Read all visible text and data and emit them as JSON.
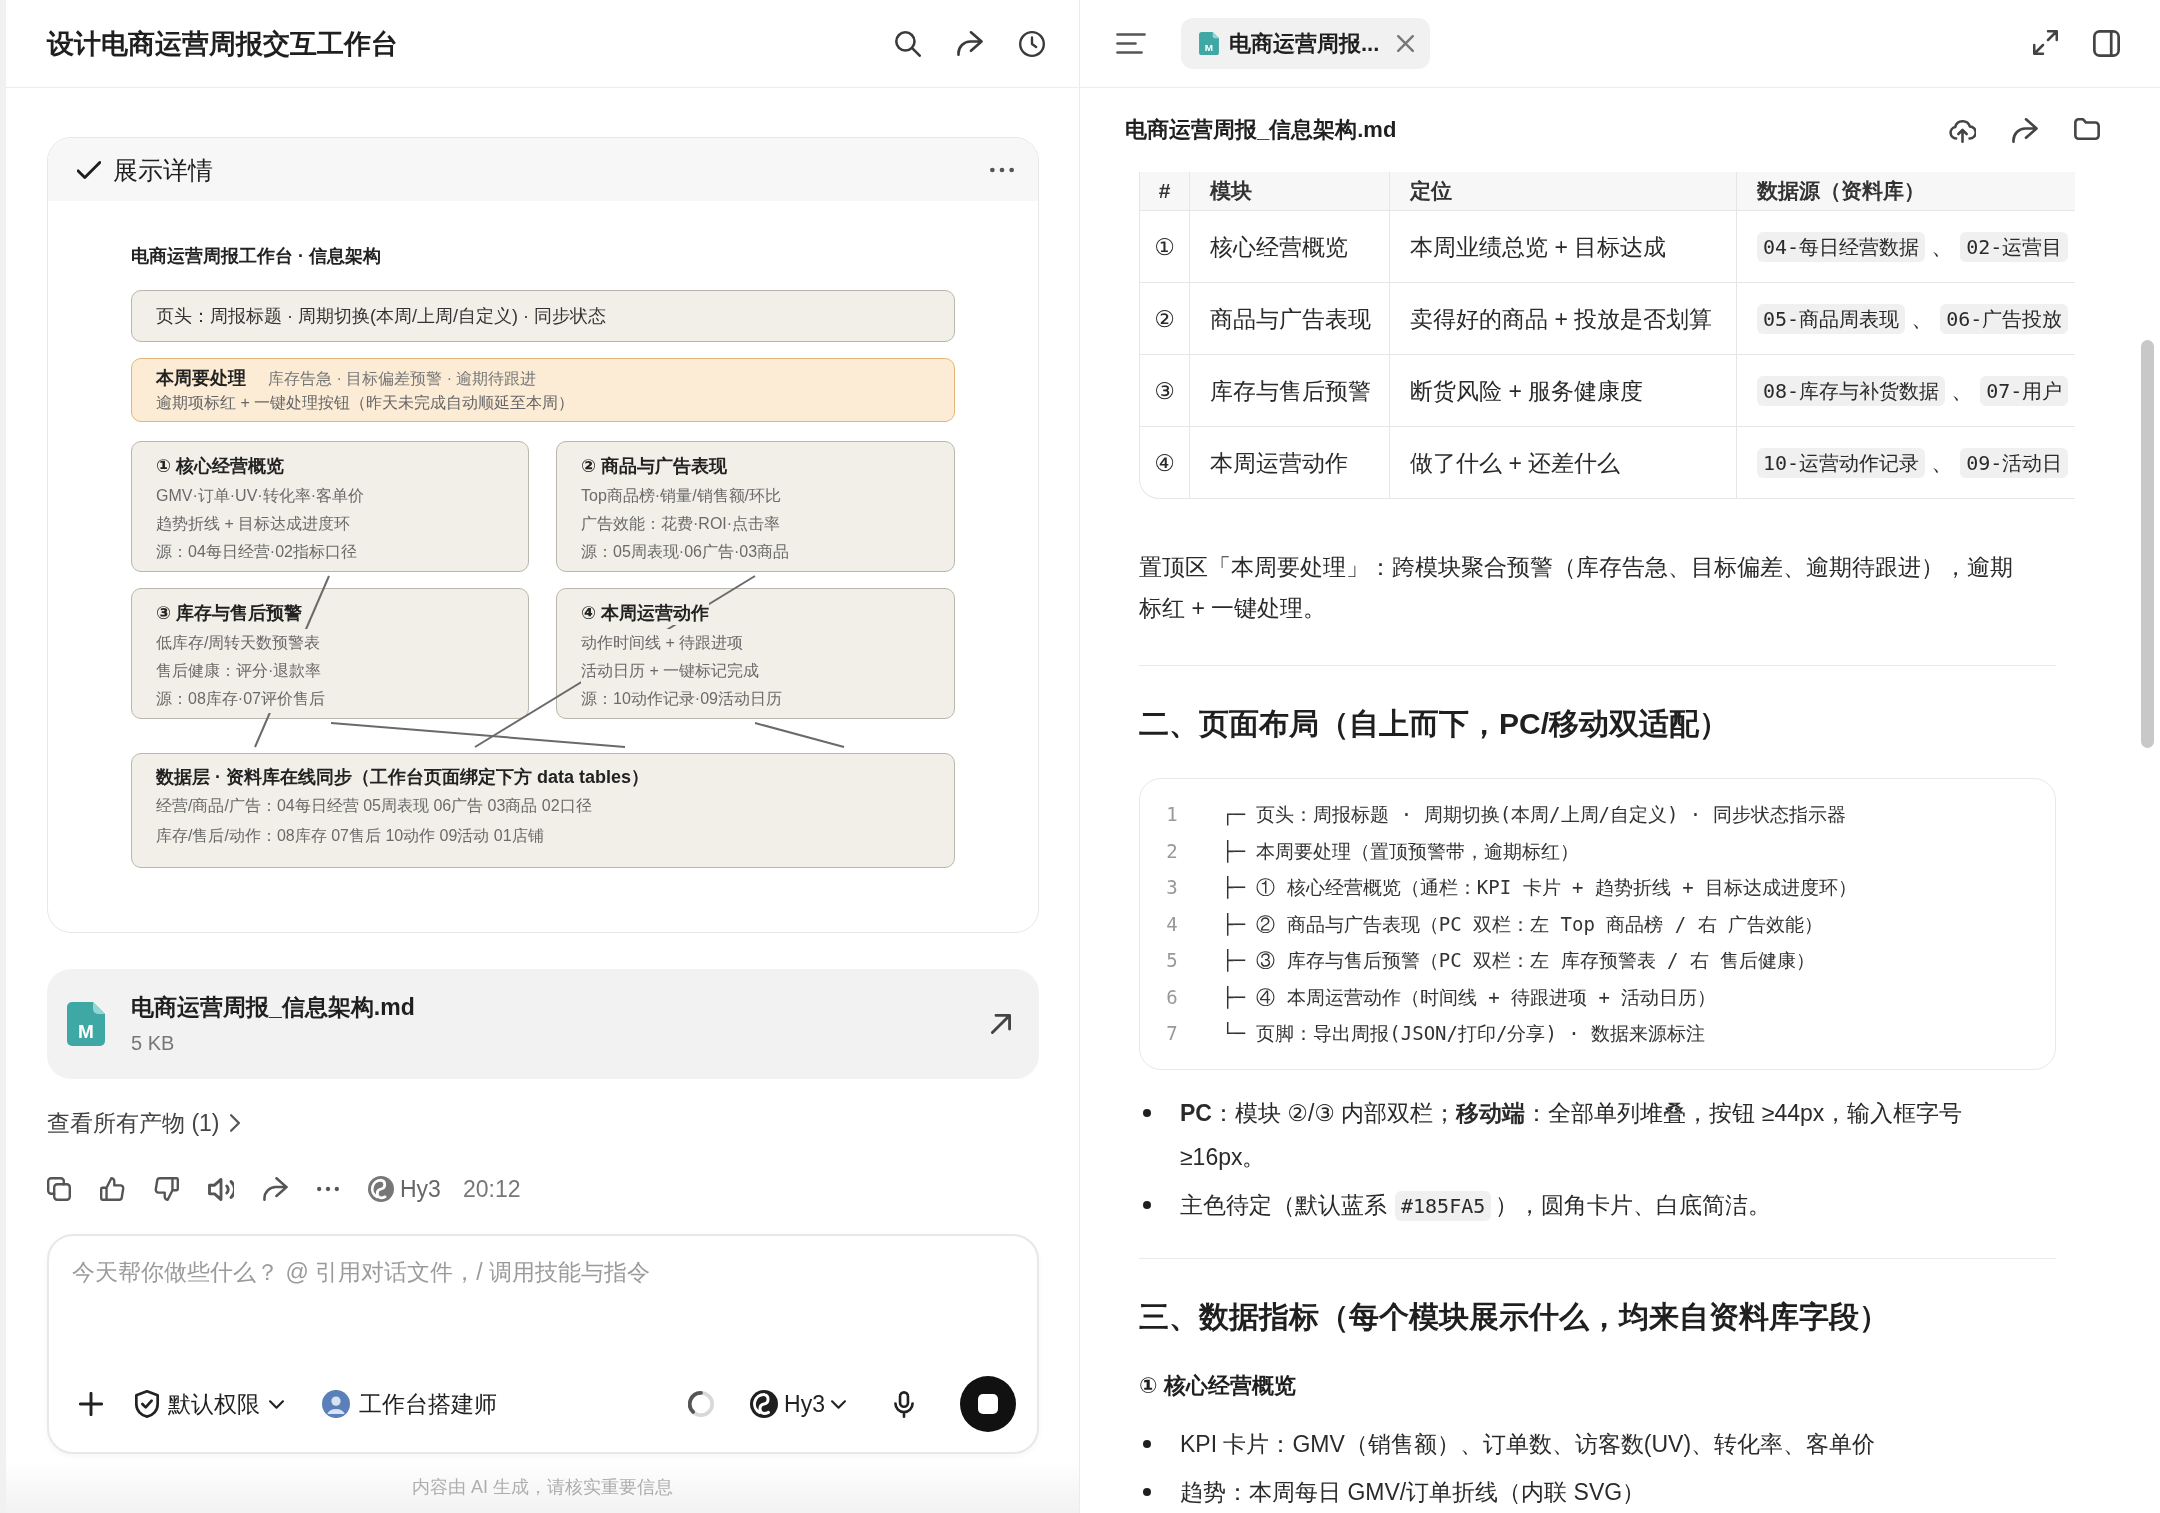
{
  "chat": {
    "title": "设计电商运营周报交互工作台",
    "details": {
      "label": "展示详情",
      "diagram": {
        "title": "电商运营周报工作台 · 信息架构",
        "header_box": "页头：周报标题 · 周期切换(本周/上周/自定义) · 同步状态",
        "priority_box": {
          "title": "本周要处理",
          "tags": "库存告急 · 目标偏差预警 · 逾期待跟进",
          "note": "逾期项标红 + 一键处理按钮（昨天未完成自动顺延至本周）"
        },
        "modules": [
          {
            "title": "① 核心经营概览",
            "lines": [
              "GMV·订单·UV·转化率·客单价",
              "趋势折线 + 目标达成进度环",
              "源：04每日经营·02指标口径"
            ]
          },
          {
            "title": "② 商品与广告表现",
            "lines": [
              "Top商品榜·销量/销售额/环比",
              "广告效能：花费·ROI·点击率",
              "源：05周表现·06广告·03商品"
            ]
          },
          {
            "title": "③ 库存与售后预警",
            "lines": [
              "低库存/周转天数预警表",
              "售后健康：评分·退款率",
              "源：08库存·07评价售后"
            ]
          },
          {
            "title": "④ 本周运营动作",
            "lines": [
              "动作时间线 + 待跟进项",
              "活动日历 + 一键标记完成",
              "源：10动作记录·09活动日历"
            ]
          }
        ],
        "data_layer": {
          "title": "数据层 · 资料库在线同步（工作台页面绑定下方 data tables）",
          "lines": [
            "经营/商品/广告：04每日经营 05周表现 06广告 03商品 02口径",
            "库存/售后/动作：08库存 07售后 10动作 09活动 01店铺"
          ]
        }
      }
    },
    "file_card": {
      "badge": "M",
      "name": "电商运营周报_信息架构.md",
      "size": "5 KB"
    },
    "artifacts_link": "查看所有产物 (1)",
    "message_meta": {
      "model": "Hy3",
      "time": "20:12"
    },
    "composer": {
      "placeholder": "今天帮你做些什么？ @ 引用对话文件，/ 调用技能与指令",
      "permission": "默认权限",
      "agent": "工作台搭建师",
      "model": "Hy3",
      "generating": true
    },
    "disclaimer": "内容由 AI 生成，请核实重要信息"
  },
  "viewer": {
    "tabs": [
      {
        "badge": "M",
        "label": "电商运营周报...",
        "selected": true
      }
    ],
    "filename": "电商运营周报_信息架构.md",
    "table": {
      "columns": [
        "#",
        "模块",
        "定位",
        "数据源（资料库）"
      ],
      "rows": [
        {
          "index": "①",
          "module": "核心经营概览",
          "purpose": "本周业绩总览 + 目标达成",
          "sources": [
            {
              "kind": "code",
              "text": "04-每日经营数据"
            },
            {
              "kind": "text",
              "text": "、"
            },
            {
              "kind": "code",
              "text": "02-运营目"
            }
          ]
        },
        {
          "index": "②",
          "module": "商品与广告表现",
          "purpose": "卖得好的商品 + 投放是否划算",
          "sources": [
            {
              "kind": "code",
              "text": "05-商品周表现"
            },
            {
              "kind": "text",
              "text": "、"
            },
            {
              "kind": "code",
              "text": "06-广告投放"
            }
          ]
        },
        {
          "index": "③",
          "module": "库存与售后预警",
          "purpose": "断货风险 + 服务健康度",
          "sources": [
            {
              "kind": "code",
              "text": "08-库存与补货数据"
            },
            {
              "kind": "text",
              "text": "、"
            },
            {
              "kind": "code",
              "text": "07-用户"
            }
          ]
        },
        {
          "index": "④",
          "module": "本周运营动作",
          "purpose": "做了什么 + 还差什么",
          "sources": [
            {
              "kind": "code",
              "text": "10-运营动作记录"
            },
            {
              "kind": "text",
              "text": "、"
            },
            {
              "kind": "code",
              "text": "09-活动日"
            }
          ]
        }
      ]
    },
    "blocks": [
      {
        "kind": "paragraph",
        "segments": [
          {
            "kind": "text",
            "text": "置顶区「本周要处理」：跨模块聚合预警（库存告急、目标偏差、逾期待跟进），逾期标红 + 一键处理。"
          }
        ]
      },
      {
        "kind": "rule"
      },
      {
        "kind": "heading2",
        "text": "二、页面布局（自上而下，PC/移动双适配）"
      },
      {
        "kind": "code",
        "lines": [
          {
            "number": "1",
            "text": "┌─ 页头：周报标题 · 周期切换(本周/上周/自定义) · 同步状态指示器"
          },
          {
            "number": "2",
            "text": "├─ 本周要处理（置顶预警带，逾期标红）"
          },
          {
            "number": "3",
            "text": "├─ ① 核心经营概览（通栏：KPI 卡片 + 趋势折线 + 目标达成进度环）"
          },
          {
            "number": "4",
            "text": "├─ ② 商品与广告表现（PC 双栏：左 Top 商品榜 / 右 广告效能）"
          },
          {
            "number": "5",
            "text": "├─ ③ 库存与售后预警（PC 双栏：左 库存预警表 / 右 售后健康）"
          },
          {
            "number": "6",
            "text": "├─ ④ 本周运营动作（时间线 + 待跟进项 + 活动日历）"
          },
          {
            "number": "7",
            "text": "└─ 页脚：导出周报(JSON/打印/分享) · 数据来源标注"
          }
        ]
      },
      {
        "kind": "bullets",
        "items": [
          {
            "segments": [
              {
                "kind": "text",
                "text": "**PC**：模块 ②/③ 内部双栏；**移动端**：全部单列堆叠，按钮 ≥44px，输入框字号 ≥16px。"
              }
            ]
          },
          {
            "segments": [
              {
                "kind": "text",
                "text": "主色待定（默认蓝系"
              },
              {
                "kind": "code",
                "text": "#185FA5"
              },
              {
                "kind": "text",
                "text": "），圆角卡片、白底简洁。"
              }
            ]
          }
        ]
      },
      {
        "kind": "rule"
      },
      {
        "kind": "heading2",
        "text": "三、数据指标（每个模块展示什么，均来自资料库字段）"
      },
      {
        "kind": "heading3",
        "text": "① 核心经营概览"
      },
      {
        "kind": "bullets",
        "items": [
          {
            "segments": [
              {
                "kind": "text",
                "text": "KPI 卡片：GMV（销售额）、订单数、访客数(UV)、转化率、客单价"
              }
            ]
          },
          {
            "segments": [
              {
                "kind": "text",
                "text": "趋势：本周每日 GMV/订单折线（内联 SVG）"
              }
            ]
          }
        ]
      }
    ]
  }
}
